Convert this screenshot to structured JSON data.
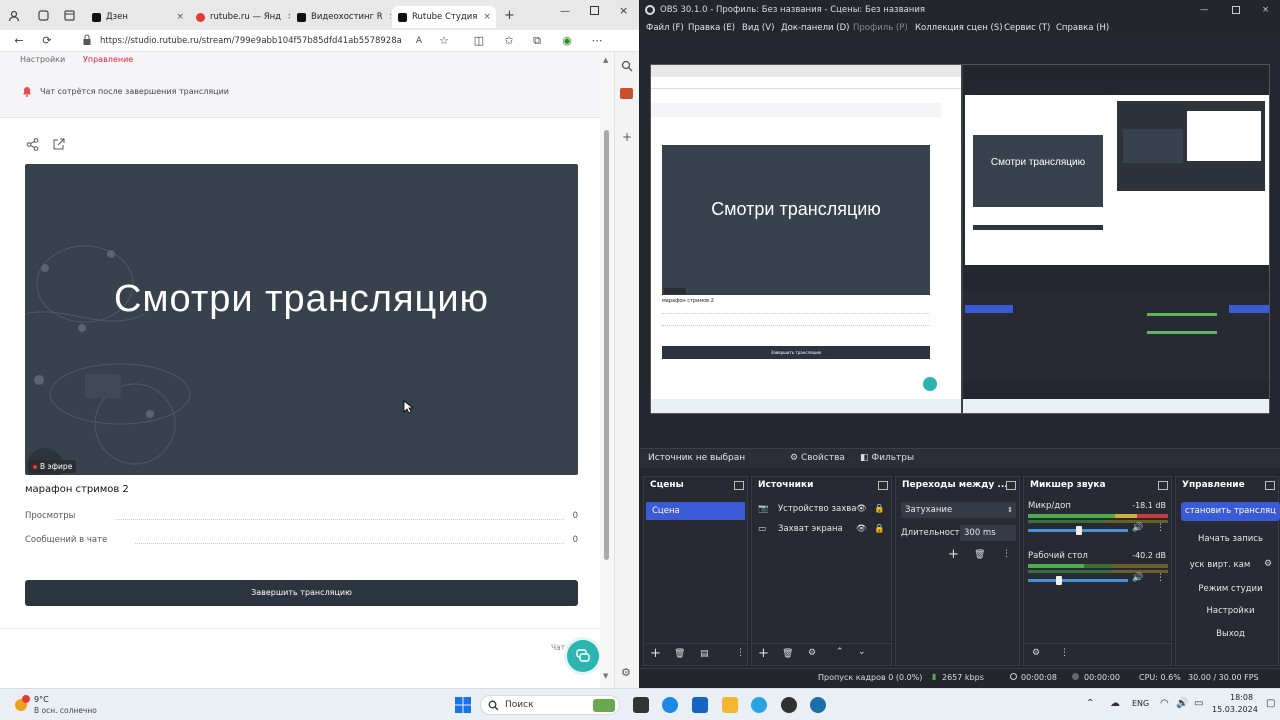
{
  "browser": {
    "tabs": [
      {
        "label": "Дзен",
        "color": "#111111"
      },
      {
        "label": "rutube.ru — Янд",
        "color": "#e53935"
      },
      {
        "label": "Видеохостинг R",
        "color": "#111111"
      },
      {
        "label": "Rutube Студия",
        "color": "#111111"
      }
    ],
    "new_tab": "+",
    "url": "https://studio.rutube.ru/stream/799e9abb104f57b85dfd41ab5578928a"
  },
  "page": {
    "top_tabs": [
      "Настройки",
      "Управление"
    ],
    "chat_notice": "Чат сотрётся после завершения трансляции",
    "player_title": "Смотри трансляцию",
    "live_badge": "В эфире",
    "stream_title": "марафон стримов 2",
    "views_label": "Просмотры",
    "views_value": "0",
    "messages_label": "Сообщений в чате",
    "messages_value": "0",
    "end_button": "Завершить трансляцию",
    "chat_label": "Чат"
  },
  "obs": {
    "window_title": "OBS 30.1.0 - Профиль: Без названия - Сцены: Без названия",
    "menu": [
      "Файл (F)",
      "Правка (E)",
      "Вид (V)",
      "Док-панели (D)",
      "Профиль (P)",
      "Коллекция сцен (S)",
      "Сервис (T)",
      "Справка (H)"
    ],
    "no_source": "Источник не выбран",
    "properties": "Свойства",
    "filters": "Фильтры",
    "scenes": {
      "title": "Сцены",
      "items": [
        "Сцена"
      ]
    },
    "sources": {
      "title": "Источники",
      "items": [
        "Устройство захва",
        "Захват экрана"
      ]
    },
    "transitions": {
      "title": "Переходы между ...",
      "type": "Затухание",
      "duration_label": "Длительность",
      "duration": "300 ms"
    },
    "mixer": {
      "title": "Микшер звука",
      "channels": [
        {
          "name": "Микр/доп",
          "db": "-18.1 dB"
        },
        {
          "name": "Рабочий стол",
          "db": "-40.2 dB"
        }
      ]
    },
    "controls": {
      "title": "Управление",
      "buttons": [
        "становить трансляц",
        "Начать запись",
        "уск вирт. кам",
        "Режим студии",
        "Настройки",
        "Выход"
      ]
    },
    "status": {
      "dropped": "Пропуск кадров 0 (0.0%)",
      "bitrate": "2657 kbps",
      "stream_time": "00:00:08",
      "rec_time": "00:00:00",
      "cpu": "CPU: 0.6%",
      "fps": "30.00 / 30.00 FPS"
    }
  },
  "taskbar": {
    "weather_temp": "9°C",
    "weather_desc": "В осн. солнечно",
    "search": "Поиск",
    "lang": "ENG",
    "time": "18:08",
    "date": "15.03.2024"
  },
  "colors": {
    "accent_blue": "#3b5bd6",
    "rutube_dark": "#2c3440",
    "chat_teal": "#2bb5ae"
  }
}
